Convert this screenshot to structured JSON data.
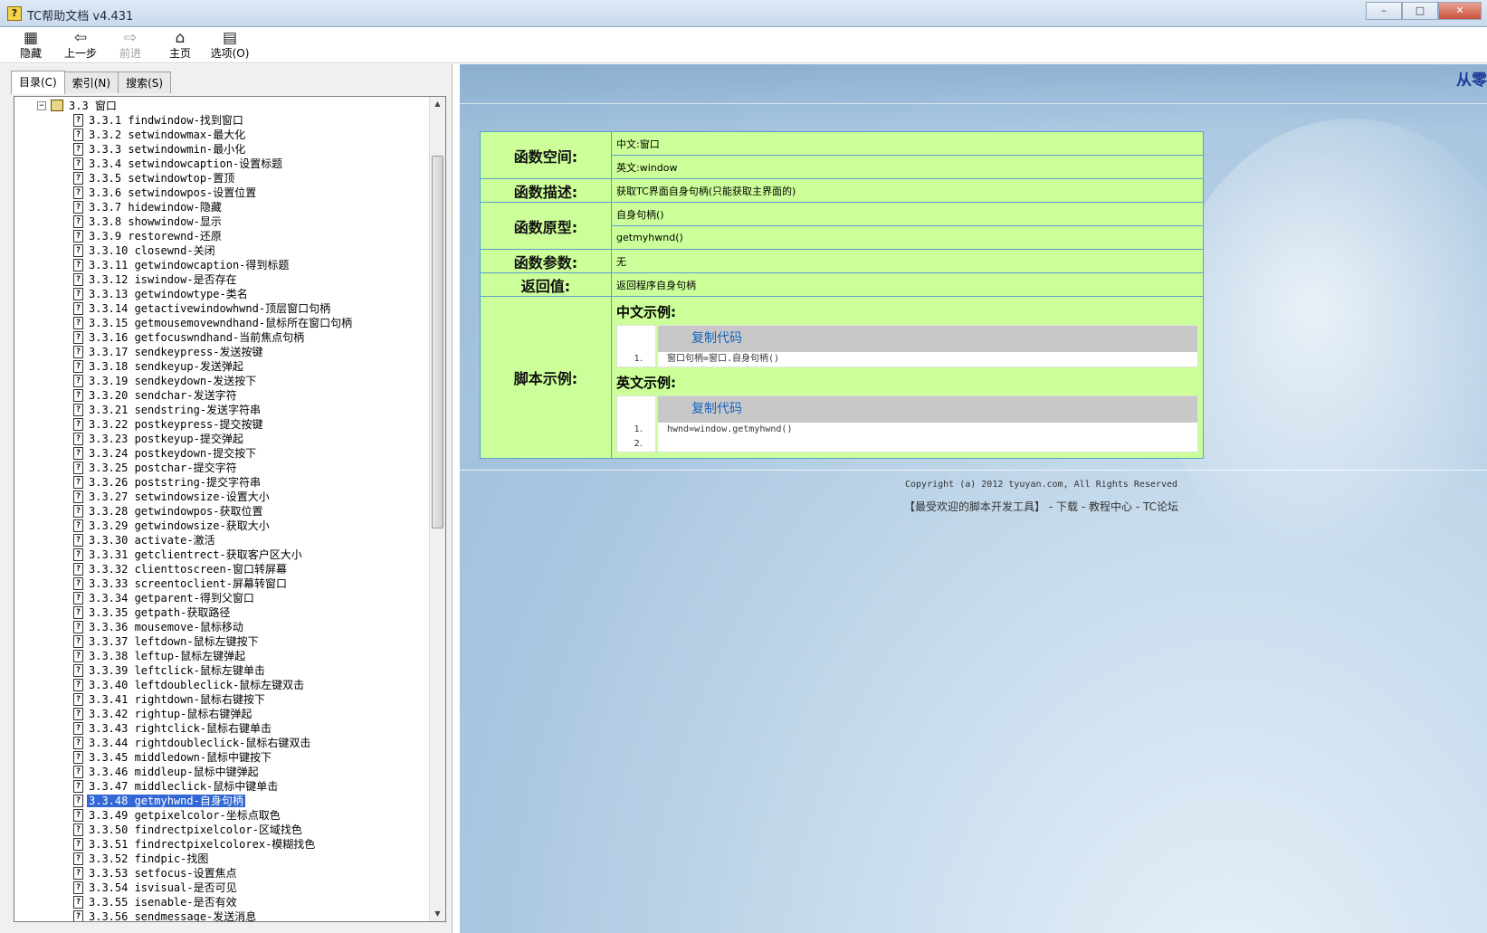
{
  "window": {
    "title": "TC帮助文档 v4.431",
    "buttons": [
      "–",
      "□",
      "✕"
    ]
  },
  "toolbar": {
    "hide": "隐藏",
    "back": "上一步",
    "forward": "前进",
    "home": "主页",
    "options": "选项(O)"
  },
  "tabs": {
    "contents": "目录(C)",
    "index": "索引(N)",
    "search": "搜索(S)"
  },
  "tree": {
    "root": "3.3 窗口",
    "items": [
      "3.3.1 findwindow-找到窗口",
      "3.3.2 setwindowmax-最大化",
      "3.3.3 setwindowmin-最小化",
      "3.3.4 setwindowcaption-设置标题",
      "3.3.5 setwindowtop-置顶",
      "3.3.6 setwindowpos-设置位置",
      "3.3.7 hidewindow-隐藏",
      "3.3.8 showwindow-显示",
      "3.3.9 restorewnd-还原",
      "3.3.10 closewnd-关闭",
      "3.3.11 getwindowcaption-得到标题",
      "3.3.12 iswindow-是否存在",
      "3.3.13 getwindowtype-类名",
      "3.3.14 getactivewindowhwnd-顶层窗口句柄",
      "3.3.15 getmousemovewndhand-鼠标所在窗口句柄",
      "3.3.16 getfocuswndhand-当前焦点句柄",
      "3.3.17 sendkeypress-发送按键",
      "3.3.18 sendkeyup-发送弹起",
      "3.3.19 sendkeydown-发送按下",
      "3.3.20 sendchar-发送字符",
      "3.3.21 sendstring-发送字符串",
      "3.3.22 postkeypress-提交按键",
      "3.3.23 postkeyup-提交弹起",
      "3.3.24 postkeydown-提交按下",
      "3.3.25 postchar-提交字符",
      "3.3.26 poststring-提交字符串",
      "3.3.27 setwindowsize-设置大小",
      "3.3.28 getwindowpos-获取位置",
      "3.3.29 getwindowsize-获取大小",
      "3.3.30 activate-激活",
      "3.3.31 getclientrect-获取客户区大小",
      "3.3.32 clienttoscreen-窗口转屏幕",
      "3.3.33 screentoclient-屏幕转窗口",
      "3.3.34 getparent-得到父窗口",
      "3.3.35 getpath-获取路径",
      "3.3.36 mousemove-鼠标移动",
      "3.3.37 leftdown-鼠标左键按下",
      "3.3.38 leftup-鼠标左键弹起",
      "3.3.39 leftclick-鼠标左键单击",
      "3.3.40 leftdoubleclick-鼠标左键双击",
      "3.3.41 rightdown-鼠标右键按下",
      "3.3.42 rightup-鼠标右键弹起",
      "3.3.43 rightclick-鼠标右键单击",
      "3.3.44 rightdoubleclick-鼠标右键双击",
      "3.3.45 middledown-鼠标中键按下",
      "3.3.46 middleup-鼠标中键弹起",
      "3.3.47 middleclick-鼠标中键单击",
      "3.3.48 getmyhwnd-自身句柄",
      "3.3.49 getpixelcolor-坐标点取色",
      "3.3.50 findrectpixelcolor-区域找色",
      "3.3.51 findrectpixelcolorex-模糊找色",
      "3.3.52 findpic-找图",
      "3.3.53 setfocus-设置焦点",
      "3.3.54 isvisual-是否可见",
      "3.3.55 isenable-是否有效",
      "3.3.56 sendmessage-发送消息"
    ],
    "selected_index": 47
  },
  "content": {
    "corner_title": "从零",
    "rows": {
      "namespace_label": "函数空间:",
      "namespace_cn": "中文:窗口",
      "namespace_en": "英文:window",
      "desc_label": "函数描述:",
      "desc": "获取TC界面自身句柄(只能获取主界面的)",
      "proto_label": "函数原型:",
      "proto_cn": "自身句柄()",
      "proto_en": "getmyhwnd()",
      "params_label": "函数参数:",
      "params": "无",
      "return_label": "返回值:",
      "return": "返回程序自身句柄",
      "example_label": "脚本示例:"
    },
    "examples": {
      "cn_head": "中文示例:",
      "cn_copy": "复制代码",
      "cn_ln1": "1.",
      "cn_code": "窗口句柄=窗口.自身句柄()",
      "en_head": "英文示例:",
      "en_copy": "复制代码",
      "en_ln1": "1.",
      "en_ln2": "2.",
      "en_code": "hwnd=window.getmyhwnd()"
    },
    "footer": {
      "copyright": "Copyright (a) 2012 tyuyan.com, All Rights Reserved",
      "slogan": "【最受欢迎的脚本开发工具】",
      "sep": " - ",
      "download": "下载",
      "tutorials": "教程中心",
      "forum": "TC论坛"
    }
  },
  "colors": {
    "table_bg": "#ccff99",
    "border": "#5aa0d0",
    "selected": "#3168d5",
    "link": "#1565c0"
  }
}
